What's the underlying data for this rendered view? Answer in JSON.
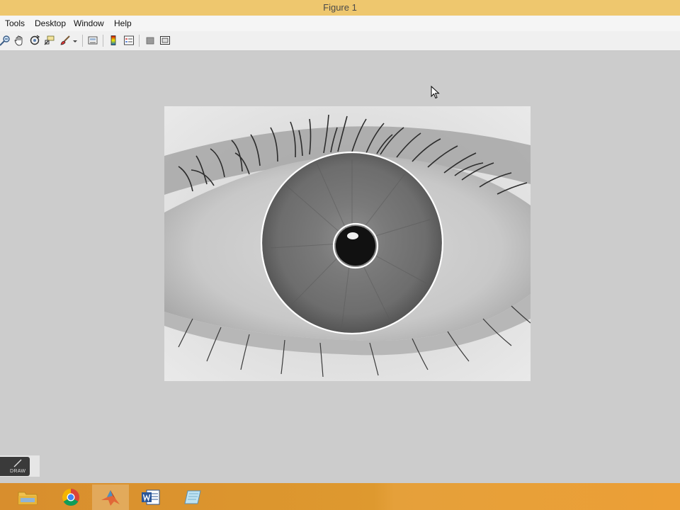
{
  "window": {
    "title": "Figure 1"
  },
  "menubar": {
    "items": [
      {
        "id": "tools",
        "label": "Tools"
      },
      {
        "id": "desktop",
        "label": "Desktop"
      },
      {
        "id": "window",
        "label": "Window"
      },
      {
        "id": "help",
        "label": "Help"
      }
    ]
  },
  "toolbar": {
    "icons": [
      "zoom-out-icon",
      "pan-icon",
      "rotate-3d-icon",
      "data-cursor-icon",
      "brush-icon",
      "link-plot-icon",
      "colorbar-icon",
      "legend-icon",
      "hide-plot-tools-icon",
      "show-plot-tools-icon"
    ]
  },
  "figure": {
    "image": "grayscale-eye-image",
    "overlays": [
      "iris-boundary-circle",
      "pupil-boundary-circle"
    ],
    "overlay_color": "#ffffff"
  },
  "draw_widget": {
    "label": "DRAW"
  },
  "taskbar": {
    "apps": [
      "file-explorer-icon",
      "chrome-icon",
      "matlab-icon",
      "word-icon",
      "notepad-icon"
    ],
    "active_app": "matlab-icon"
  },
  "colors": {
    "titlebar": "#eec76e",
    "figure_background": "#cccccc",
    "taskbar": "#de992f"
  }
}
